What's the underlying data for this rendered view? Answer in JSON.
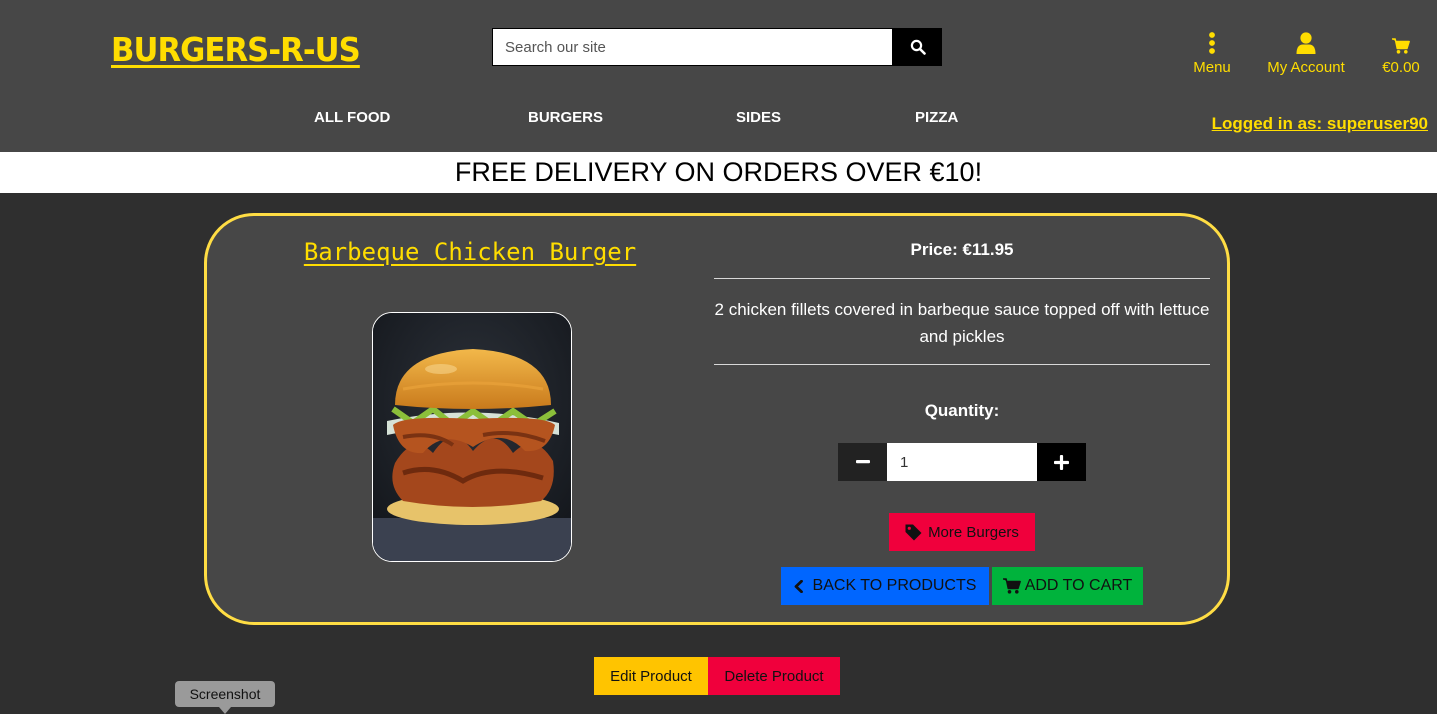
{
  "header": {
    "logo": "BURGERS-R-US",
    "search_placeholder": "Search our site",
    "menu_label": "Menu",
    "account_label": "My Account",
    "cart_total": "€0.00",
    "nav": [
      "ALL FOOD",
      "BURGERS",
      "SIDES",
      "PIZZA"
    ],
    "logged_in": "Logged in as: superuser90"
  },
  "banner": "FREE DELIVERY ON ORDERS OVER €10!",
  "product": {
    "name": "Barbeque Chicken Burger",
    "price": "Price: €11.95",
    "description": "2 chicken fillets covered in barbeque sauce topped off with lettuce and pickles",
    "quantity_label": "Quantity:",
    "quantity_value": "1",
    "more_button": "More Burgers",
    "back_button": "BACK TO PRODUCTS",
    "add_button": "ADD TO CART"
  },
  "admin": {
    "edit": "Edit Product",
    "delete": "Delete Product"
  },
  "tooltip": "Screenshot",
  "colors": {
    "accent": "#ffdd00",
    "header_bg": "#474747",
    "page_bg": "#2f2f2f",
    "card_border": "#ffdd44",
    "danger": "#f0003c",
    "primary": "#0066ff",
    "success": "#00b33c",
    "warning": "#ffc400"
  },
  "icons": {
    "search": "search-icon",
    "menu": "vertical-dots-icon",
    "account": "user-icon",
    "cart": "cart-icon",
    "minus": "minus-icon",
    "plus": "plus-icon",
    "tag": "tag-icon",
    "back": "chevron-left-icon"
  }
}
